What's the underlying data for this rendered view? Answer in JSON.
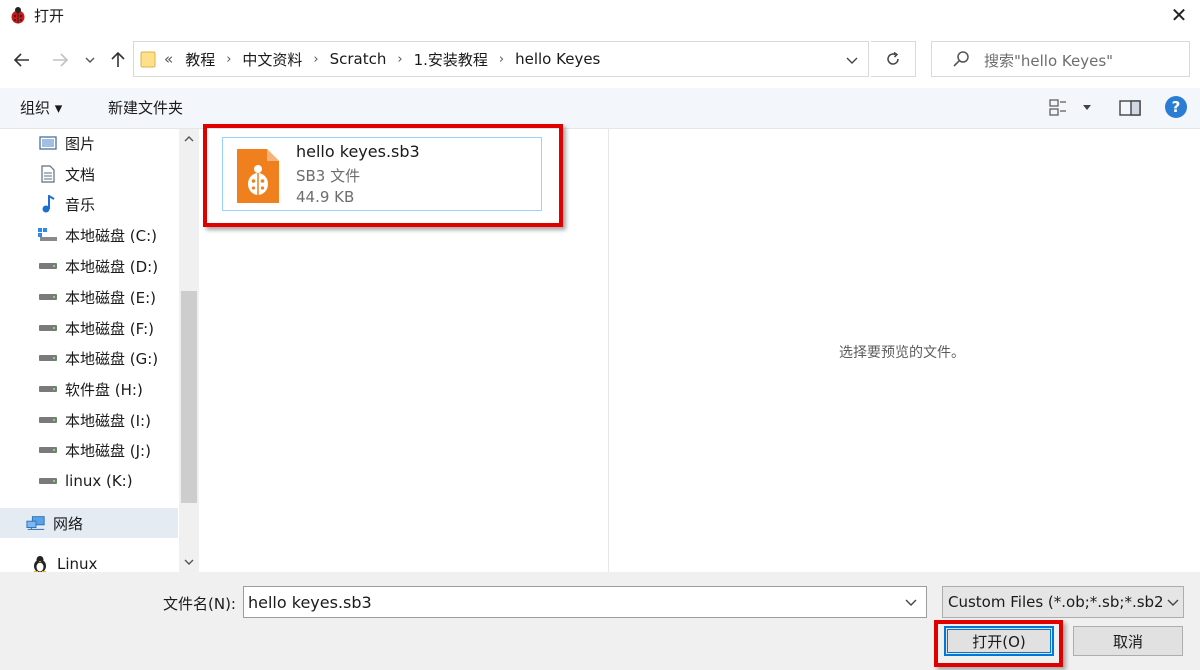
{
  "window": {
    "title": "打开",
    "close_symbol": "✕"
  },
  "address": {
    "overflow": "«",
    "crumbs": [
      "教程",
      "中文资料",
      "Scratch",
      "1.安装教程",
      "hello Keyes"
    ],
    "separator": "›"
  },
  "search": {
    "placeholder": "搜索\"hello Keyes\""
  },
  "toolbar": {
    "organize_label": "组织 ▾",
    "new_folder_label": "新建文件夹"
  },
  "nav": {
    "items": [
      {
        "label": "图片",
        "icon": "pictures-icon"
      },
      {
        "label": "文档",
        "icon": "documents-icon"
      },
      {
        "label": "音乐",
        "icon": "music-icon"
      },
      {
        "label": "本地磁盘 (C:)",
        "icon": "system-drive-icon"
      },
      {
        "label": "本地磁盘 (D:)",
        "icon": "drive-icon"
      },
      {
        "label": "本地磁盘 (E:)",
        "icon": "drive-icon"
      },
      {
        "label": "本地磁盘 (F:)",
        "icon": "drive-icon"
      },
      {
        "label": "本地磁盘 (G:)",
        "icon": "drive-icon"
      },
      {
        "label": "软件盘 (H:)",
        "icon": "drive-icon"
      },
      {
        "label": "本地磁盘 (I:)",
        "icon": "drive-icon"
      },
      {
        "label": "本地磁盘 (J:)",
        "icon": "drive-icon"
      },
      {
        "label": "linux (K:)",
        "icon": "drive-icon"
      },
      {
        "label": "网络",
        "icon": "network-icon"
      },
      {
        "label": "Linux",
        "icon": "linux-penguin-icon"
      }
    ]
  },
  "file": {
    "name": "hello keyes.sb3",
    "type": "SB3 文件",
    "size": "44.9 KB",
    "icon": "scratch-ladybug-file-icon",
    "icon_color": "#f07f1e"
  },
  "preview": {
    "message": "选择要预览的文件。"
  },
  "bottom": {
    "filename_label": "文件名(N):",
    "filename_value": "hello keyes.sb3",
    "filter_value": "Custom Files (*.ob;*.sb;*.sb2;",
    "open_label": "打开(O)",
    "cancel_label": "取消"
  },
  "colors": {
    "highlight": "#e00000",
    "accent": "#0078d7"
  }
}
